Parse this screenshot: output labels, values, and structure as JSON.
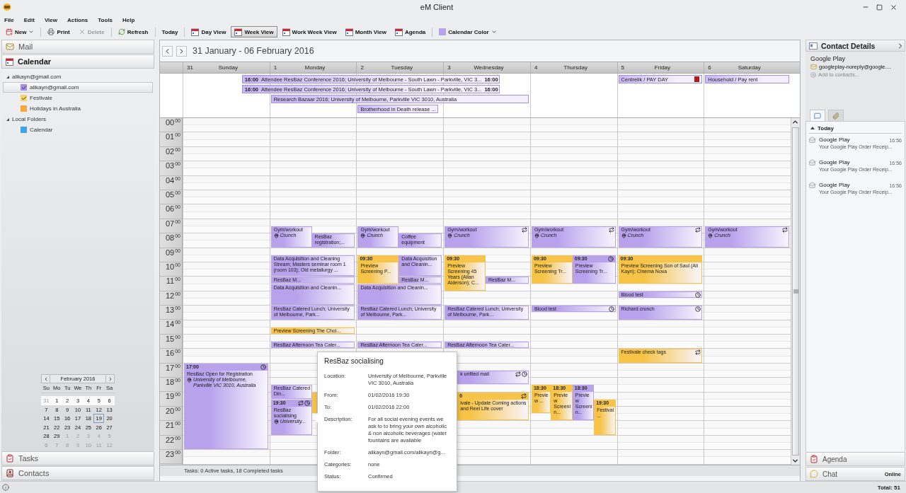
{
  "window": {
    "title": "eM Client"
  },
  "menu": [
    "File",
    "Edit",
    "View",
    "Actions",
    "Tools",
    "Help"
  ],
  "actions": [
    {
      "label": "New",
      "disabled": false
    },
    {
      "label": "Print",
      "disabled": false
    },
    {
      "label": "Delete",
      "disabled": true
    },
    {
      "label": "Refresh",
      "disabled": false
    },
    {
      "label": "Today",
      "disabled": false
    }
  ],
  "views": [
    {
      "label": "Day View",
      "selected": false
    },
    {
      "label": "Week View",
      "selected": true
    },
    {
      "label": "Work Week View",
      "selected": false
    },
    {
      "label": "Month View",
      "selected": false
    },
    {
      "label": "Agenda",
      "selected": false
    }
  ],
  "calendar_color": {
    "label": "Calendar Color",
    "color": "#b8a2ec"
  },
  "nav_top": [
    {
      "label": "Mail",
      "selected": false
    },
    {
      "label": "Calendar",
      "selected": true
    }
  ],
  "folders": [
    {
      "label": "alikayn@gmail.com",
      "expanded": true,
      "children": [
        {
          "label": "alikayn@gmail.com",
          "color": "#a98be8",
          "checked": true,
          "selected": true
        },
        {
          "label": "Festivale",
          "color": "#f8d36a",
          "checked": true,
          "selected": false
        },
        {
          "label": "Holidays in Australia",
          "color": "#f6a83a",
          "checked": false,
          "selected": false
        }
      ]
    },
    {
      "label": "Local Folders",
      "expanded": true,
      "children": [
        {
          "label": "Calendar",
          "color": "#3aa6e8",
          "checked": false,
          "selected": false
        }
      ]
    }
  ],
  "mini_calendar": {
    "title": "February 2016",
    "weekdays": [
      "Su",
      "Mo",
      "Tu",
      "We",
      "Th",
      "Fr",
      "Sa"
    ],
    "weeks": [
      {
        "current": true,
        "days": [
          {
            "label": "31",
            "other_month": true,
            "selected": false
          },
          {
            "label": "1",
            "other_month": false,
            "selected": false
          },
          {
            "label": "2",
            "other_month": false,
            "selected": false
          },
          {
            "label": "3",
            "other_month": false,
            "selected": false
          },
          {
            "label": "4",
            "other_month": false,
            "selected": false
          },
          {
            "label": "5",
            "other_month": false,
            "selected": false
          },
          {
            "label": "6",
            "other_month": false,
            "selected": false
          }
        ]
      },
      {
        "current": false,
        "days": [
          {
            "label": "7",
            "other_month": false,
            "selected": false
          },
          {
            "label": "8",
            "other_month": false,
            "selected": false
          },
          {
            "label": "9",
            "other_month": false,
            "selected": false
          },
          {
            "label": "10",
            "other_month": false,
            "selected": false
          },
          {
            "label": "11",
            "other_month": false,
            "selected": false
          },
          {
            "label": "12",
            "other_month": false,
            "selected": false
          },
          {
            "label": "13",
            "other_month": false,
            "selected": false
          }
        ]
      },
      {
        "current": false,
        "days": [
          {
            "label": "14",
            "other_month": false,
            "selected": false
          },
          {
            "label": "15",
            "other_month": false,
            "selected": false
          },
          {
            "label": "16",
            "other_month": false,
            "selected": false
          },
          {
            "label": "17",
            "other_month": false,
            "selected": false
          },
          {
            "label": "18",
            "other_month": false,
            "selected": false
          },
          {
            "label": "19",
            "other_month": false,
            "selected": true
          },
          {
            "label": "20",
            "other_month": false,
            "selected": false
          }
        ]
      },
      {
        "current": false,
        "days": [
          {
            "label": "21",
            "other_month": false,
            "selected": false
          },
          {
            "label": "22",
            "other_month": false,
            "selected": false
          },
          {
            "label": "23",
            "other_month": false,
            "selected": false
          },
          {
            "label": "24",
            "other_month": false,
            "selected": false
          },
          {
            "label": "25",
            "other_month": false,
            "selected": false
          },
          {
            "label": "26",
            "other_month": false,
            "selected": false
          },
          {
            "label": "27",
            "other_month": false,
            "selected": false
          }
        ]
      },
      {
        "current": false,
        "days": [
          {
            "label": "28",
            "other_month": false,
            "selected": false
          },
          {
            "label": "29",
            "other_month": false,
            "selected": false
          },
          {
            "label": "1",
            "other_month": true,
            "selected": false
          },
          {
            "label": "2",
            "other_month": true,
            "selected": false
          },
          {
            "label": "3",
            "other_month": true,
            "selected": false
          },
          {
            "label": "4",
            "other_month": true,
            "selected": false
          },
          {
            "label": "5",
            "other_month": true,
            "selected": false
          }
        ]
      },
      {
        "current": false,
        "days": [
          {
            "label": "6",
            "other_month": true,
            "selected": false
          },
          {
            "label": "7",
            "other_month": true,
            "selected": false
          },
          {
            "label": "8",
            "other_month": true,
            "selected": false
          },
          {
            "label": "9",
            "other_month": true,
            "selected": false
          },
          {
            "label": "10",
            "other_month": true,
            "selected": false
          },
          {
            "label": "11",
            "other_month": true,
            "selected": false
          },
          {
            "label": "12",
            "other_month": true,
            "selected": false
          }
        ]
      }
    ]
  },
  "nav_bottom": [
    {
      "label": "Tasks"
    },
    {
      "label": "Contacts"
    }
  ],
  "calendar": {
    "range": "31 January - 06 February 2016",
    "hours": [
      {
        "hour": "00",
        "minutes": "00"
      },
      {
        "hour": "01",
        "minutes": "00"
      },
      {
        "hour": "02",
        "minutes": "00"
      },
      {
        "hour": "03",
        "minutes": "00"
      },
      {
        "hour": "04",
        "minutes": "00"
      },
      {
        "hour": "05",
        "minutes": "00"
      },
      {
        "hour": "06",
        "minutes": "00"
      },
      {
        "hour": "07",
        "minutes": "00"
      },
      {
        "hour": "08",
        "minutes": "00"
      },
      {
        "hour": "09",
        "minutes": "00"
      },
      {
        "hour": "10",
        "minutes": "00"
      },
      {
        "hour": "11",
        "minutes": "00"
      },
      {
        "hour": "12",
        "minutes": "00"
      },
      {
        "hour": "13",
        "minutes": "00"
      },
      {
        "hour": "14",
        "minutes": "00"
      },
      {
        "hour": "15",
        "minutes": "00"
      },
      {
        "hour": "16",
        "minutes": "00"
      },
      {
        "hour": "17",
        "minutes": "00"
      },
      {
        "hour": "18",
        "minutes": "00"
      },
      {
        "hour": "19",
        "minutes": "00"
      },
      {
        "hour": "20",
        "minutes": "00"
      },
      {
        "hour": "21",
        "minutes": "00"
      },
      {
        "hour": "22",
        "minutes": "00"
      },
      {
        "hour": "23",
        "minutes": "00"
      }
    ],
    "all_day": [
      {
        "start_time": "16:00",
        "end_time": "16:00",
        "title": "Attendee ResBaz Conference 2016; University of Melbourne - South Lawn - Parkville, VIC 3..."
      },
      {
        "start_time": "16:00",
        "end_time": "16:00",
        "title": "Attendee ResBaz Conference 2016; University of Melbourne - South Lawn - Parkville, VIC 3..."
      },
      {
        "title": "Research Bazaar 2016; University of Melbourne, Parkville VIC 3010, Australia"
      },
      {
        "title": "Brotherhood in Death release ..."
      },
      {
        "title": "Centrelik / PAY DAY",
        "color": "#b01c1c"
      },
      {
        "title": "Household / Pay rent"
      }
    ],
    "days": [
      {
        "number": "31",
        "name": "Sunday",
        "events": [
          {
            "time": "17:00",
            "title": "ResBaz Open for Registration",
            "location": "University of Melbourne, Parkville VIC 3010, Australia",
            "color": "#b8a2ec",
            "recurring": false,
            "reminder": true
          }
        ]
      },
      {
        "number": "1",
        "name": "Monday",
        "events": [
          {
            "title": "Gym/workout",
            "location": "Crunch",
            "color": "#b8a2ec",
            "recurring": false,
            "reminder": false
          },
          {
            "title": "ResBaz registration;...",
            "color": "#b8a2ec",
            "recurring": false,
            "reminder": false
          },
          {
            "title": "Data Acquisition and Cleaning Stream; Masters seminar room 1 (room 103); Old metallurgy ...",
            "color": "#b8a2ec",
            "recurring": false,
            "reminder": false
          },
          {
            "title": "ResBaz M...",
            "color": "#b8a2ec",
            "recurring": false,
            "reminder": false
          },
          {
            "title": "Data Acquisition and Cleanin...",
            "color": "#b8a2ec",
            "recurring": false,
            "reminder": false
          },
          {
            "title": "ResBaz Catered Lunch; University of Melbourne, Park...",
            "color": "#b8a2ec",
            "recurring": false,
            "reminder": false
          },
          {
            "title": "Preview Screening The Choi...",
            "color": "#f7c448",
            "recurring": false,
            "reminder": false
          },
          {
            "title": "ResBaz Afternoon Tea Cater...",
            "color": "#b8a2ec",
            "recurring": false,
            "reminder": false
          },
          {
            "title": "ResBaz Catered Din...",
            "color": "#b8a2ec",
            "recurring": false,
            "reminder": false
          },
          {
            "color": "#f7c448"
          },
          {
            "time": "19:30",
            "title": "ResBaz socialising",
            "location": "University...",
            "color": "#b8a2ec",
            "recurring": true,
            "reminder": true
          }
        ]
      },
      {
        "number": "2",
        "name": "Tuesday",
        "events": [
          {
            "title": "Gym/workout",
            "location": "Crunch",
            "color": "#b8a2ec",
            "recurring": false,
            "reminder": false
          },
          {
            "title": "Coffee equipment",
            "color": "#b8a2ec",
            "recurring": false,
            "reminder": false
          },
          {
            "time": "09:30",
            "title": "Preview Screening P...",
            "color": "#f7c448",
            "recurring": false,
            "reminder": false
          },
          {
            "title": "Data Acquisition and Cleanin...",
            "color": "#b8a2ec",
            "recurring": false,
            "reminder": false
          },
          {
            "title": "ResBaz M...",
            "color": "#b8a2ec",
            "recurring": false,
            "reminder": false
          },
          {
            "title": "Data Acquisition and Cleanin...",
            "color": "#b8a2ec",
            "recurring": false,
            "reminder": false
          },
          {
            "title": "ResBaz Catered Lunch; University of Melbourne, Park...",
            "color": "#b8a2ec",
            "recurring": false,
            "reminder": false
          },
          {
            "title": "ResBaz Afternoon Tea Cater...",
            "color": "#b8a2ec",
            "recurring": false,
            "reminder": false
          }
        ]
      },
      {
        "number": "3",
        "name": "Wednesday",
        "events": [
          {
            "title": "Gym/workout",
            "location": "Crunch",
            "color": "#b8a2ec",
            "recurring": true,
            "reminder": false
          },
          {
            "time": "09:30",
            "title": "Preview Screening 45 Years (Allan Alderson); C...",
            "color": "#f7c448",
            "recurring": false,
            "reminder": false
          },
          {
            "title": "ResBaz M...",
            "color": "#b8a2ec",
            "recurring": false,
            "reminder": false
          },
          {
            "title": "ResBaz Catered Lunch; University of Melbourne, Park...",
            "color": "#b8a2ec",
            "recurring": false,
            "reminder": false
          },
          {
            "title": "ResBaz Afternoon Tea Cater...",
            "color": "#b8a2ec",
            "recurring": false,
            "reminder": false
          },
          {
            "title": "k unfiled mail",
            "color": "#b8a2ec",
            "recurring": true,
            "reminder": true,
            "covered": true
          },
          {
            "time": "0",
            "title": "ivale - Update Coming actions and Reel Life cover",
            "color": "#f7c448",
            "recurring": true,
            "reminder": false,
            "covered": true
          }
        ]
      },
      {
        "number": "4",
        "name": "Thursday",
        "events": [
          {
            "title": "Gym/workout",
            "location": "Crunch",
            "color": "#b8a2ec",
            "recurring": true,
            "reminder": false
          },
          {
            "time": "09:30",
            "title": "Preview Screening Tr...",
            "color": "#f7c448",
            "recurring": false,
            "reminder": false
          },
          {
            "time": "09:30",
            "title": "Preview Screening Tr...",
            "color": "#b8a2ec",
            "recurring": false,
            "reminder": true
          },
          {
            "title": "Blood test",
            "color": "#b8a2ec",
            "recurring": false,
            "reminder": true
          },
          {
            "time": "18:30",
            "title": "Preview ...",
            "color": "#f7c448",
            "recurring": false,
            "reminder": false
          },
          {
            "time": "18:30",
            "title": "Preview Screenin...",
            "color": "#f7c448",
            "recurring": false,
            "reminder": false
          },
          {
            "time": "18:30",
            "title": "Preview Screenin...",
            "color": "#b8a2ec",
            "recurring": false,
            "reminder": false
          },
          {
            "time": "19:30",
            "title": "Festival...",
            "color": "#f7c448",
            "recurring": false,
            "reminder": false
          }
        ]
      },
      {
        "number": "5",
        "name": "Friday",
        "events": [
          {
            "title": "Gym/workout",
            "location": "Crunch",
            "color": "#b8a2ec",
            "recurring": true,
            "reminder": false
          },
          {
            "time": "09:30",
            "title": "Preview Screening Son of Saul (Ali Kayn); Cinema Nova",
            "color": "#f7c448",
            "recurring": false,
            "reminder": false
          },
          {
            "title": "Blood test",
            "color": "#b8a2ec",
            "recurring": false,
            "reminder": true
          },
          {
            "title": "Richard crunch",
            "color": "#b8a2ec",
            "recurring": false,
            "reminder": true
          },
          {
            "title": "Festivale check tags",
            "color": "#f7c448",
            "recurring": true,
            "reminder": false
          }
        ]
      },
      {
        "number": "6",
        "name": "Saturday",
        "events": [
          {
            "title": "Gym/workout",
            "location": "Crunch",
            "color": "#b8a2ec",
            "recurring": true,
            "reminder": false
          }
        ]
      }
    ],
    "task_summary": "Tasks: 0 Active tasks, 18 Completed tasks"
  },
  "tooltip": {
    "title": "ResBaz socialising",
    "fields": [
      {
        "label": "Location:",
        "value": "University of Melbourne, Parkville VIC 3010, Australia"
      },
      {
        "label": "From:",
        "value": "01/02/2016 19:30"
      },
      {
        "label": "To:",
        "value": "01/02/2016 22:00"
      },
      {
        "label": "Description:",
        "value": "For all social evening events we ask to to bring your own alcoholic & non alcoholic beverages (water fountains are available"
      },
      {
        "label": "Folder:",
        "value": "alikayn@gmail.com/alikayn@g..."
      },
      {
        "label": "Categories:",
        "value": "none"
      },
      {
        "label": "Status:",
        "value": "Confirmed"
      }
    ]
  },
  "contact": {
    "title": "Contact Details",
    "name": "Google Play",
    "email": "googleplay-noreply@google....",
    "add_link": "Add to contacts..."
  },
  "contact_tabs": [
    {
      "selected": true
    },
    {
      "selected": false
    }
  ],
  "messages": {
    "group": "Today",
    "expanded": true,
    "items": [
      {
        "sender": "Google Play",
        "time": "16:56",
        "subject": "Your Google Play Order Receip..."
      },
      {
        "sender": "Google Play",
        "time": "16:56",
        "subject": "Your Google Play Order Receip..."
      },
      {
        "sender": "Google Play",
        "time": "16:56",
        "subject": "Your Google Play Order Receip..."
      }
    ]
  },
  "right_nav": [
    {
      "label": "Agenda"
    },
    {
      "label": "Chat",
      "status": "Online"
    }
  ],
  "status_bar": {
    "total": "Total: 51"
  }
}
